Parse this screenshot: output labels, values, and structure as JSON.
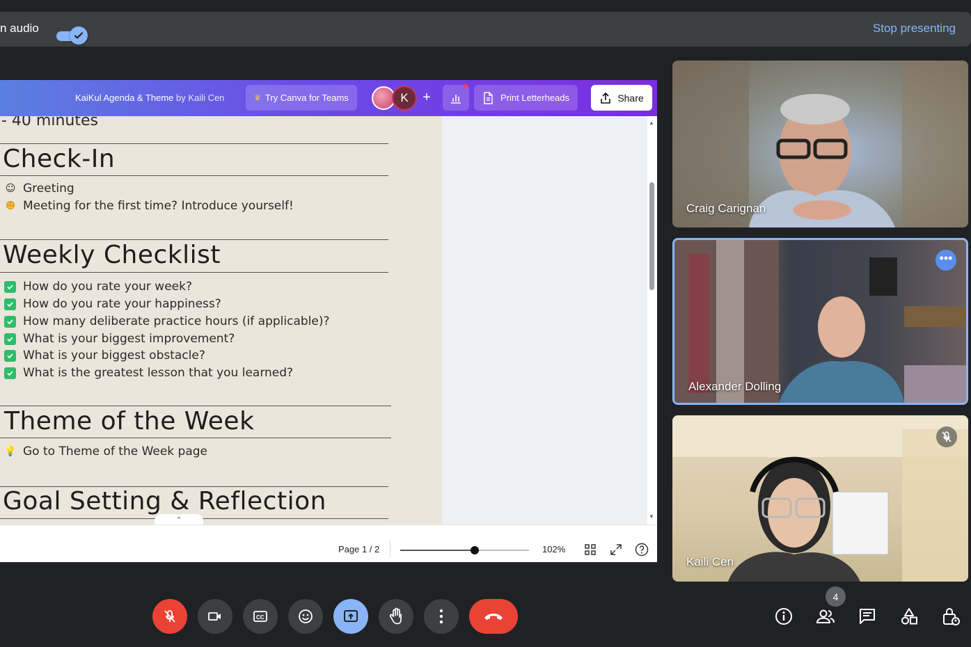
{
  "present_bar": {
    "audio_label": "n audio",
    "stop_label": "Stop presenting"
  },
  "canva": {
    "title": "KaiKul Agenda & Theme",
    "by": "by Kaili Cen",
    "try_teams": "Try Canva for Teams",
    "avatar_letter": "K",
    "add_label": "+",
    "print_label": "Print Letterheads",
    "share_label": "Share"
  },
  "document": {
    "minutes_text": "- 40 minutes",
    "sections": [
      {
        "heading": "Check-In",
        "items": [
          {
            "icon": "smiling-face-icon",
            "text": "Greeting"
          },
          {
            "icon": "hugging-face-icon",
            "text": "Meeting for the first time? Introduce yourself!"
          }
        ]
      },
      {
        "heading": "Weekly Checklist",
        "items": [
          {
            "icon": "checkbox-icon",
            "text": "How do you rate your week?"
          },
          {
            "icon": "checkbox-icon",
            "text": "How do you rate your happiness?"
          },
          {
            "icon": "checkbox-icon",
            "text": "How many deliberate practice hours (if applicable)?"
          },
          {
            "icon": "checkbox-icon",
            "text": "What is your biggest improvement?"
          },
          {
            "icon": "checkbox-icon",
            "text": "What is your biggest obstacle?"
          },
          {
            "icon": "checkbox-icon",
            "text": "What is the greatest lesson that you learned?"
          }
        ]
      },
      {
        "heading": "Theme of the Week",
        "items": [
          {
            "icon": "lightbulb-icon",
            "text": "Go to Theme of the Week page"
          }
        ]
      },
      {
        "heading": "Goal Setting & Reflection",
        "items": []
      }
    ]
  },
  "footer": {
    "page_label": "Page 1 / 2",
    "zoom_label": "102%",
    "zoom_level": 0.58
  },
  "participants": [
    {
      "name": "Craig Carignan"
    },
    {
      "name": "Alexander Dolling"
    },
    {
      "name": "Kaili Cen"
    }
  ],
  "controls": {
    "participant_count": "4"
  },
  "colors": {
    "accent": "#8ab4f8",
    "danger": "#ea4335",
    "canva_start": "#5b7fe0",
    "canva_end": "#7a2ee0",
    "check_green": "#2ebd6b",
    "page_bg": "#ebe6dc"
  }
}
